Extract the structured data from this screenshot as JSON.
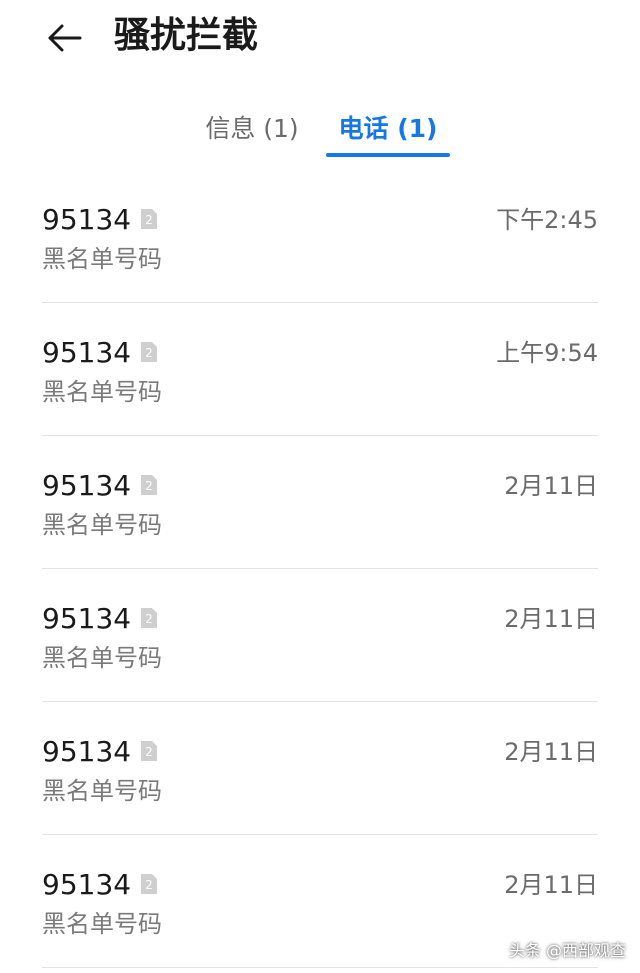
{
  "header": {
    "title": "骚扰拦截",
    "back_icon": "arrow-left-icon"
  },
  "tabs": [
    {
      "label": "信息 (1)",
      "active": false
    },
    {
      "label": "电话 (1)",
      "active": true
    }
  ],
  "accent_color": "#1677e6",
  "calls": [
    {
      "number": "95134",
      "label": "黑名单号码",
      "time": "下午2:45",
      "sim": "2"
    },
    {
      "number": "95134",
      "label": "黑名单号码",
      "time": "上午9:54",
      "sim": "2"
    },
    {
      "number": "95134",
      "label": "黑名单号码",
      "time": "2月11日",
      "sim": "2"
    },
    {
      "number": "95134",
      "label": "黑名单号码",
      "time": "2月11日",
      "sim": "2"
    },
    {
      "number": "95134",
      "label": "黑名单号码",
      "time": "2月11日",
      "sim": "2"
    },
    {
      "number": "95134",
      "label": "黑名单号码",
      "time": "2月11日",
      "sim": "2"
    }
  ],
  "watermark": "头条 @西部观查"
}
